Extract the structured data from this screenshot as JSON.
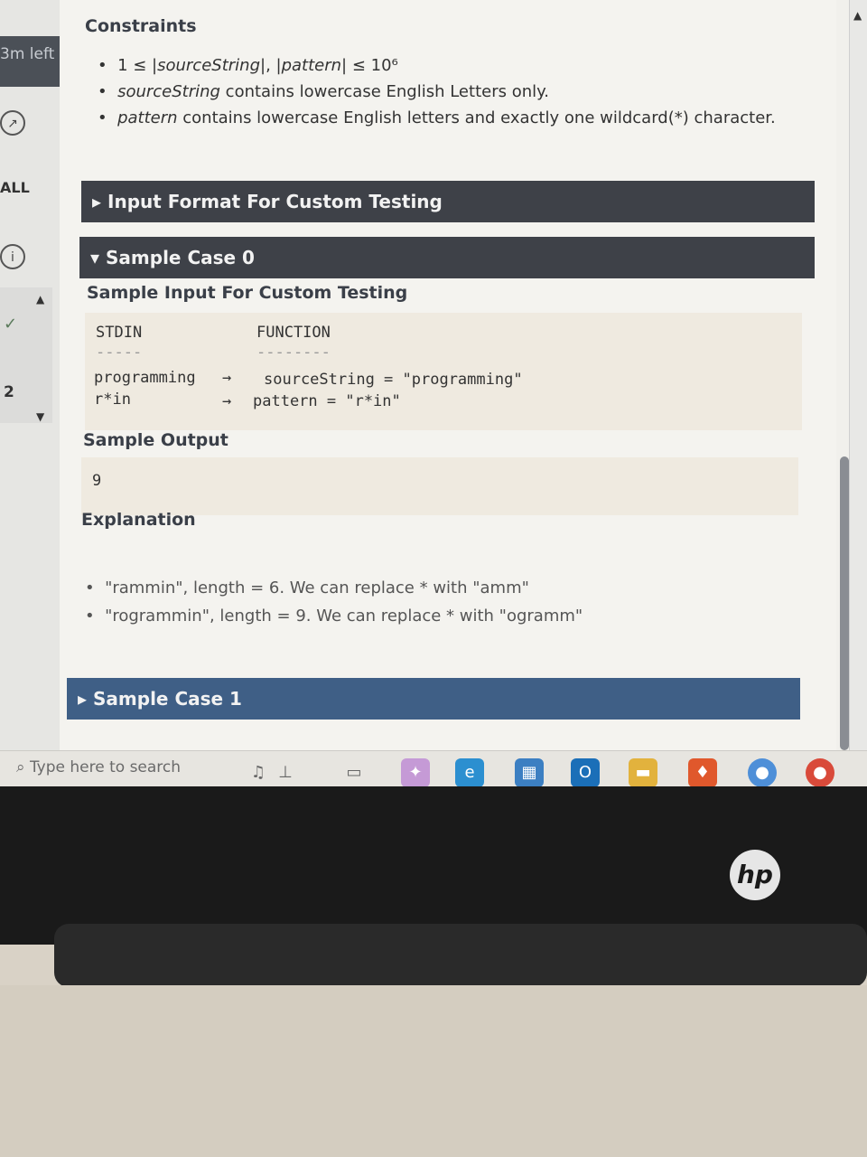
{
  "sidebar": {
    "timer": "3m left",
    "all_label": "ALL",
    "question_number": "2"
  },
  "constraints": {
    "heading": "Constraints",
    "items": [
      {
        "pre": "1 ≤ |",
        "italic1": "sourceString",
        "mid": "|, |",
        "italic2": "pattern",
        "post": "| ≤ 10⁶"
      },
      {
        "italic": "sourceString",
        "text": " contains lowercase English Letters only."
      },
      {
        "italic": "pattern",
        "text": " contains lowercase English letters and exactly one wildcard(*) character."
      }
    ]
  },
  "sections": {
    "input_format": "Input Format For Custom Testing",
    "sample_case_0": "Sample Case 0",
    "sample_input_heading": "Sample Input For Custom Testing",
    "sample_output_heading": "Sample Output",
    "explanation_heading": "Explanation",
    "sample_case_1": "Sample Case 1"
  },
  "sample_input": {
    "col1": "STDIN",
    "col1_rule": "-----",
    "col2": "FUNCTION",
    "col2_rule": "--------",
    "rows": [
      {
        "stdin": "programming",
        "arrow": "→",
        "function": "sourceString = \"programming\""
      },
      {
        "stdin": "r*in",
        "arrow": "→",
        "function": "pattern = \"r*in\""
      }
    ]
  },
  "sample_output": "9",
  "explanation": [
    "\"rammin\", length = 6. We can replace * with \"amm\"",
    "\"rogrammin\", length = 9. We can replace * with \"ogramm\""
  ],
  "taskbar": {
    "search_placeholder": "Type here to search"
  },
  "laptop": {
    "brand": "hp"
  }
}
